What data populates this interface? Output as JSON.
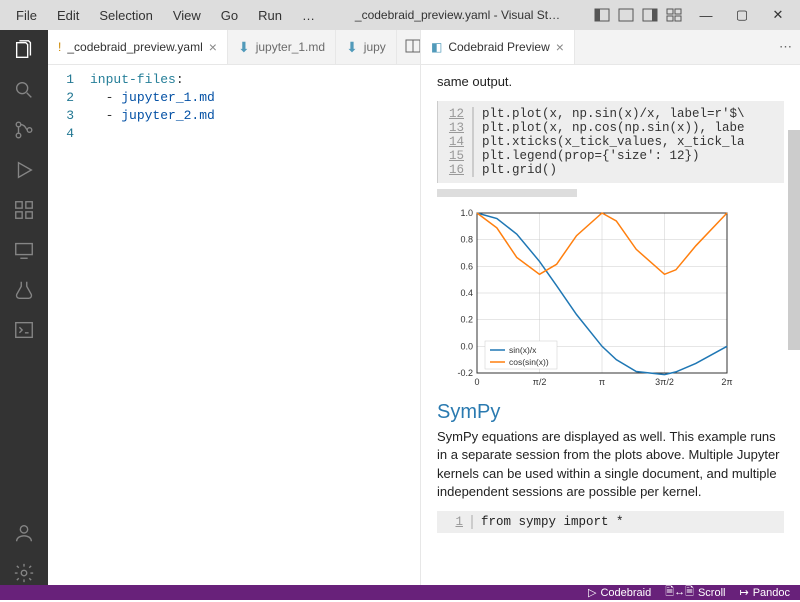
{
  "title": "_codebraid_preview.yaml - Visual St…",
  "menu": [
    "File",
    "Edit",
    "Selection",
    "View",
    "Go",
    "Run",
    "…"
  ],
  "tabs_left": [
    {
      "icon": "!",
      "label": "_codebraid_preview.yaml",
      "active": true,
      "close": true
    },
    {
      "icon": "md",
      "label": "jupyter_1.md",
      "active": false
    },
    {
      "icon": "md",
      "label": "jupy",
      "active": false
    }
  ],
  "tabs_right": [
    {
      "icon": "preview",
      "label": "Codebraid Preview",
      "active": true,
      "close": true
    }
  ],
  "editor": {
    "gutter": [
      "1",
      "2",
      "3",
      "4"
    ],
    "line1_key": "input-files",
    "line1_colon": ":",
    "line2_dash": "- ",
    "line2_val": "jupyter_1.md",
    "line3_dash": "- ",
    "line3_val": "jupyter_2.md"
  },
  "preview": {
    "intro_tail": "same output.",
    "code1_lines": [
      "12",
      "13",
      "14",
      "15",
      "16"
    ],
    "code1": [
      "plt.plot(x, np.sin(x)/x, label=r'$\\",
      "plt.plot(x, np.cos(np.sin(x)), labe",
      "plt.xticks(x_tick_values, x_tick_la",
      "plt.legend(prop={'size': 12})",
      "plt.grid()"
    ],
    "sympy_h": "SymPy",
    "sympy_p": "SymPy equations are displayed as well. This example runs in a separate session from the plots above. Multiple Jupyter kernels can be used within a single document, and multiple independent sessions are possible per kernel.",
    "code2_line": "1",
    "code2": "from sympy import *"
  },
  "status": {
    "codebraid": "Codebraid",
    "scroll": "Scroll",
    "pandoc": "Pandoc"
  },
  "chart_data": {
    "type": "line",
    "x": [
      0,
      1.5708,
      3.1416,
      4.7124,
      6.2832
    ],
    "x_ticks": [
      "0",
      "π/2",
      "π",
      "3π/2",
      "2π"
    ],
    "ylim": [
      -0.2,
      1.0
    ],
    "y_ticks": [
      -0.2,
      0.0,
      0.2,
      0.4,
      0.6,
      0.8,
      1.0
    ],
    "series": [
      {
        "name": "sin(x)/x",
        "color": "#1f77b4",
        "values": [
          1.0,
          0.637,
          0.0,
          -0.212,
          0.0
        ],
        "dense_x": [
          0,
          0.5,
          1,
          1.5708,
          2,
          2.5,
          3.1416,
          3.5,
          4,
          4.7124,
          5,
          5.5,
          6.2832
        ],
        "dense_y": [
          1.0,
          0.959,
          0.841,
          0.637,
          0.455,
          0.239,
          0.0,
          -0.1,
          -0.189,
          -0.212,
          -0.192,
          -0.128,
          0.0
        ]
      },
      {
        "name": "cos(sin(x))",
        "color": "#ff7f0e",
        "values": [
          1.0,
          0.54,
          1.0,
          0.54,
          1.0
        ],
        "dense_x": [
          0,
          0.5,
          1,
          1.5708,
          2,
          2.5,
          3.1416,
          3.5,
          4,
          4.7124,
          5,
          5.5,
          6.2832
        ],
        "dense_y": [
          1.0,
          0.888,
          0.666,
          0.54,
          0.615,
          0.83,
          1.0,
          0.94,
          0.728,
          0.54,
          0.574,
          0.754,
          1.0
        ]
      }
    ],
    "legend_pos": "lower-left",
    "grid": true
  }
}
